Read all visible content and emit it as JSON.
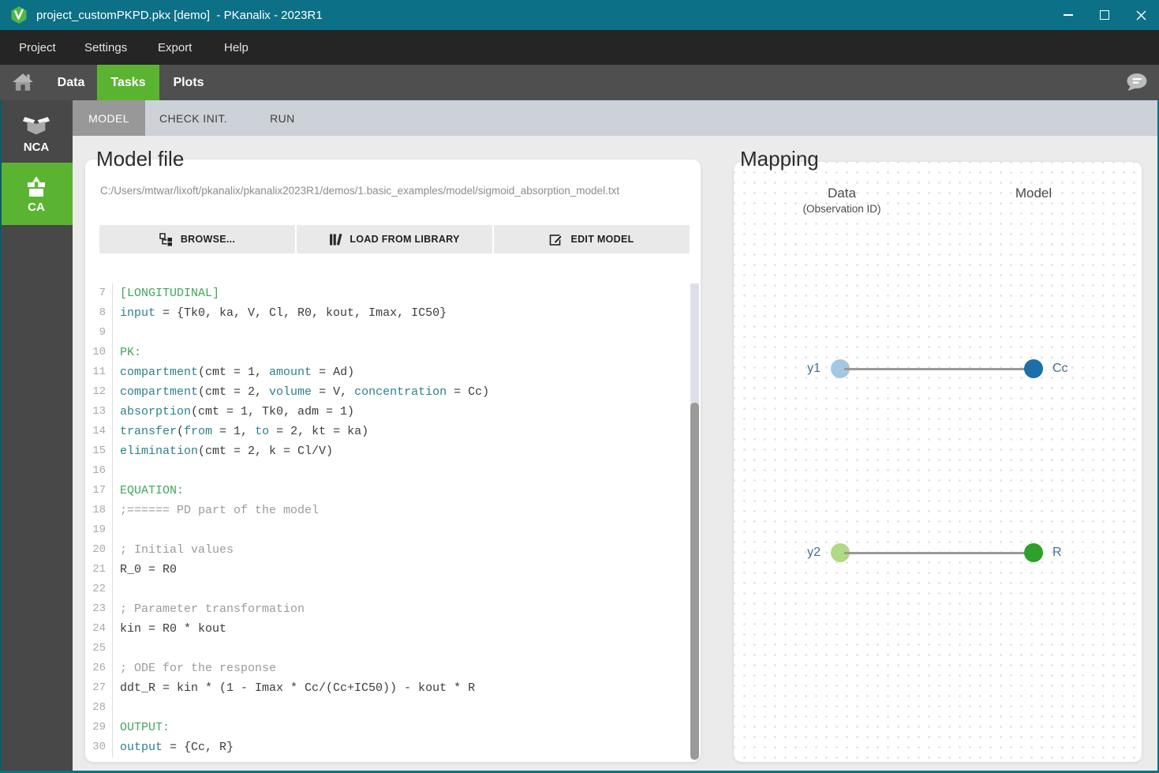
{
  "window": {
    "title": "project_customPKPD.pkx [demo]  - PKanalix - 2023R1"
  },
  "menubar": {
    "items": [
      "Project",
      "Settings",
      "Export",
      "Help"
    ]
  },
  "navbar": {
    "tabs": [
      {
        "label": "Data",
        "active": false
      },
      {
        "label": "Tasks",
        "active": true
      },
      {
        "label": "Plots",
        "active": false
      }
    ]
  },
  "sidebar": {
    "items": [
      {
        "label": "NCA",
        "active": false
      },
      {
        "label": "CA",
        "active": true
      }
    ]
  },
  "subtabs": [
    "MODEL",
    "CHECK INIT.",
    "RUN"
  ],
  "model_file": {
    "title": "Model file",
    "path": "C:/Users/mtwar/lixoft/pkanalix/pkanalix2023R1/demos/1.basic_examples/model/sigmoid_absorption_model.txt",
    "buttons": [
      {
        "label": "BROWSE...",
        "icon": "browse-tree-icon"
      },
      {
        "label": "LOAD FROM LIBRARY",
        "icon": "library-books-icon"
      },
      {
        "label": "EDIT MODEL",
        "icon": "edit-pencil-icon"
      }
    ],
    "code_lines": [
      {
        "n": 7,
        "segs": [
          {
            "t": "[LONGITUDINAL]",
            "c": "section"
          }
        ]
      },
      {
        "n": 8,
        "segs": [
          {
            "t": "input",
            "c": "keyword"
          },
          {
            "t": " = {Tk0, ka, V, Cl, R0, kout, Imax, IC50}",
            "c": "plain"
          }
        ]
      },
      {
        "n": 9,
        "segs": []
      },
      {
        "n": 10,
        "segs": [
          {
            "t": "PK:",
            "c": "section"
          }
        ]
      },
      {
        "n": 11,
        "segs": [
          {
            "t": "compartment",
            "c": "keyword"
          },
          {
            "t": "(cmt = 1, ",
            "c": "plain"
          },
          {
            "t": "amount",
            "c": "keyword"
          },
          {
            "t": " = Ad)",
            "c": "plain"
          }
        ]
      },
      {
        "n": 12,
        "segs": [
          {
            "t": "compartment",
            "c": "keyword"
          },
          {
            "t": "(cmt = 2, ",
            "c": "plain"
          },
          {
            "t": "volume",
            "c": "keyword"
          },
          {
            "t": " = V, ",
            "c": "plain"
          },
          {
            "t": "concentration",
            "c": "keyword"
          },
          {
            "t": " = Cc)",
            "c": "plain"
          }
        ]
      },
      {
        "n": 13,
        "segs": [
          {
            "t": "absorption",
            "c": "keyword"
          },
          {
            "t": "(cmt = 1, Tk0, adm = 1)",
            "c": "plain"
          }
        ]
      },
      {
        "n": 14,
        "segs": [
          {
            "t": "transfer",
            "c": "keyword"
          },
          {
            "t": "(",
            "c": "plain"
          },
          {
            "t": "from",
            "c": "keyword"
          },
          {
            "t": " = 1, ",
            "c": "plain"
          },
          {
            "t": "to",
            "c": "keyword"
          },
          {
            "t": " = 2, kt = ka)",
            "c": "plain"
          }
        ]
      },
      {
        "n": 15,
        "segs": [
          {
            "t": "elimination",
            "c": "keyword"
          },
          {
            "t": "(cmt = 2, k = Cl/V)",
            "c": "plain"
          }
        ]
      },
      {
        "n": 16,
        "segs": []
      },
      {
        "n": 17,
        "segs": [
          {
            "t": "EQUATION:",
            "c": "section"
          }
        ]
      },
      {
        "n": 18,
        "segs": [
          {
            "t": ";====== PD part of the model",
            "c": "comment"
          }
        ]
      },
      {
        "n": 19,
        "segs": []
      },
      {
        "n": 20,
        "segs": [
          {
            "t": "; Initial values",
            "c": "comment"
          }
        ]
      },
      {
        "n": 21,
        "segs": [
          {
            "t": "R_0 = R0",
            "c": "plain"
          }
        ]
      },
      {
        "n": 22,
        "segs": []
      },
      {
        "n": 23,
        "segs": [
          {
            "t": "; Parameter transformation",
            "c": "comment"
          }
        ]
      },
      {
        "n": 24,
        "segs": [
          {
            "t": "kin = R0 * kout",
            "c": "plain"
          }
        ]
      },
      {
        "n": 25,
        "segs": []
      },
      {
        "n": 26,
        "segs": [
          {
            "t": "; ODE for the response",
            "c": "comment"
          }
        ]
      },
      {
        "n": 27,
        "segs": [
          {
            "t": "ddt_R = kin * (1 - Imax * Cc/(Cc+IC50)) - kout * R",
            "c": "plain"
          }
        ]
      },
      {
        "n": 28,
        "segs": []
      },
      {
        "n": 29,
        "segs": [
          {
            "t": "OUTPUT:",
            "c": "section"
          }
        ]
      },
      {
        "n": 30,
        "segs": [
          {
            "t": "output",
            "c": "keyword"
          },
          {
            "t": " = {Cc, R}",
            "c": "plain"
          }
        ]
      }
    ]
  },
  "mapping": {
    "title": "Mapping",
    "col_data": "Data",
    "col_data_sub": "(Observation ID)",
    "col_model": "Model",
    "rows": [
      {
        "data_label": "y1",
        "model_label": "Cc",
        "data_color": "#a4c8e1",
        "model_color": "#1c6fa8"
      },
      {
        "data_label": "y2",
        "model_label": "R",
        "data_color": "#b0da83",
        "model_color": "#2fa02a"
      }
    ]
  },
  "colors": {
    "titlebar": "#0c7086",
    "accent_green": "#5bb431",
    "code_section": "#41a75e",
    "code_keyword": "#2d7f8d",
    "code_comment": "#9b9b9b",
    "code_plain": "#3c3c3c",
    "map_label": "#42708e"
  }
}
